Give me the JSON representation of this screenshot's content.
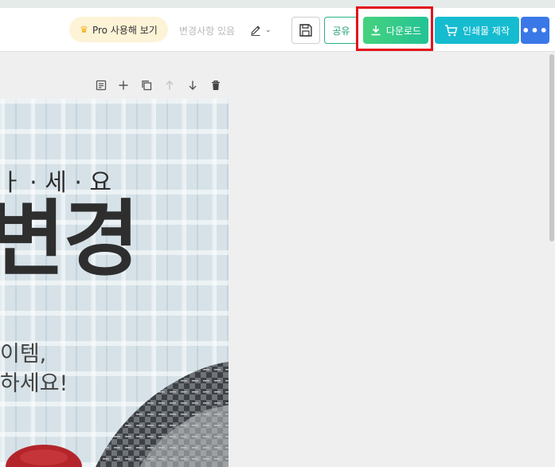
{
  "colors": {
    "download": "#2ec48a",
    "print": "#15bcd0",
    "more": "#3b78e7",
    "pro_bg": "#fdf3d7",
    "highlight": "#e4141b"
  },
  "icons": {
    "crown": "crown-icon",
    "pen": "pen-icon",
    "save": "floppy-disk-icon",
    "download": "download-arrow-icon",
    "cart": "shopping-cart-icon",
    "more": "more-dots-icon",
    "notes": "notes-icon",
    "add": "plus-icon",
    "duplicate": "duplicate-icon",
    "move_up": "arrow-up-icon",
    "move_down": "arrow-down-icon",
    "delete": "trash-icon"
  },
  "header": {
    "pro_label": "Pro 사용해 보기",
    "changes_label": "변경사항 있음",
    "crown_glyph": "♛",
    "caret": "⌄",
    "share_label": "공유",
    "download_label": "다운로드",
    "print_label": "인쇄물 제작",
    "more_glyph": "•••"
  },
  "design": {
    "line1": "ㅏ · 세 · 요",
    "line2": "변경",
    "line3": "이템,",
    "line4": "하세요!"
  }
}
